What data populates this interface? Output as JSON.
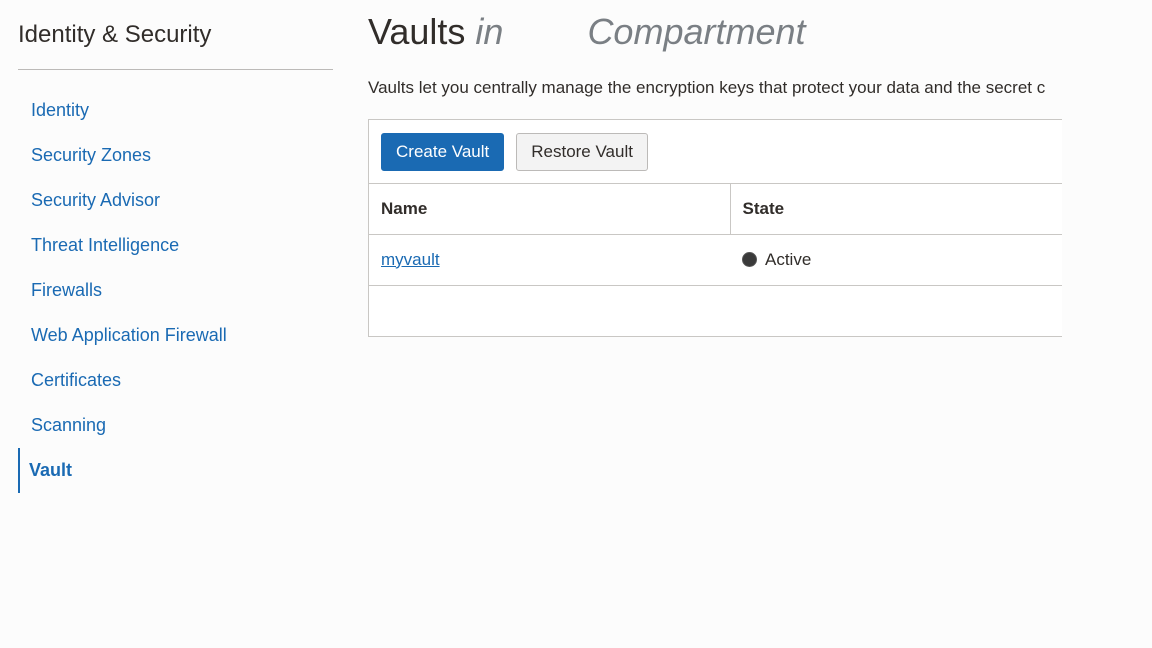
{
  "sidebar": {
    "title": "Identity & Security",
    "items": [
      {
        "label": "Identity"
      },
      {
        "label": "Security Zones"
      },
      {
        "label": "Security Advisor"
      },
      {
        "label": "Threat Intelligence"
      },
      {
        "label": "Firewalls"
      },
      {
        "label": "Web Application Firewall"
      },
      {
        "label": "Certificates"
      },
      {
        "label": "Scanning"
      },
      {
        "label": "Vault"
      }
    ],
    "active_item": "Vault"
  },
  "main": {
    "title": "Vaults",
    "title_in": "in",
    "title_compartment": "Compartment",
    "description": "Vaults let you centrally manage the encryption keys that protect your data and the secret c",
    "toolbar": {
      "create_label": "Create Vault",
      "restore_label": "Restore Vault"
    },
    "table": {
      "columns": [
        "Name",
        "State"
      ],
      "rows": [
        {
          "name": "myvault",
          "state": "Active"
        }
      ]
    }
  },
  "colors": {
    "accent": "#1a6ab3",
    "text": "#312d2a",
    "muted": "#7a7f84",
    "border": "#c9c7c4"
  }
}
